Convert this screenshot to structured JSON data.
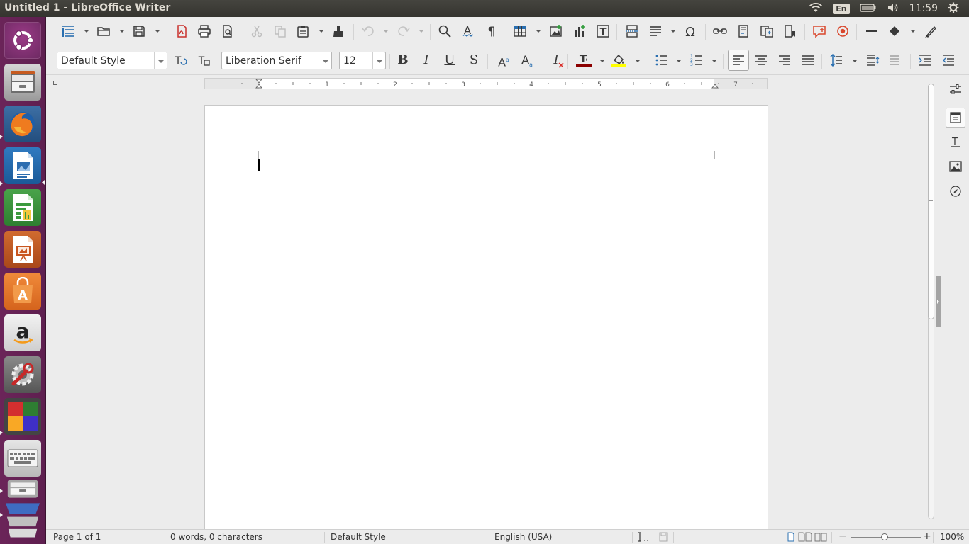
{
  "window": {
    "title": "Untitled 1 - LibreOffice Writer"
  },
  "system_tray": {
    "keyboard_layout": "En",
    "time": "11:59",
    "icons": [
      "wifi-icon",
      "keyboard-layout-indicator",
      "battery-icon",
      "volume-icon",
      "settings-gear-icon"
    ]
  },
  "launcher": {
    "items": [
      "ubuntu-dash",
      "files",
      "firefox",
      "libreoffice-writer",
      "libreoffice-calc",
      "libreoffice-impress",
      "ubuntu-software",
      "amazon",
      "system-settings",
      "workspace-switcher",
      "onscreen-keyboard",
      "files-trash-stack"
    ]
  },
  "toolbar_standard": {
    "icons": [
      "new-document",
      "open",
      "save",
      "export-pdf",
      "print",
      "print-preview",
      "cut",
      "copy",
      "paste",
      "clone-formatting",
      "undo",
      "redo",
      "find-replace",
      "spelling",
      "formatting-marks",
      "insert-table",
      "insert-image",
      "insert-chart",
      "insert-text-box",
      "insert-page-break",
      "insert-field",
      "insert-special-character",
      "insert-hyperlink",
      "insert-footnote",
      "insert-endnote",
      "insert-bookmark",
      "insert-comment",
      "track-changes",
      "insert-line",
      "basic-shapes",
      "show-draw-functions"
    ]
  },
  "toolbar_formatting": {
    "paragraph_style": "Default Style",
    "font_name": "Liberation Serif",
    "font_size": "12",
    "buttons": {
      "bold": "B",
      "italic": "I",
      "underline": "U",
      "strikethrough": "S",
      "superscript": "A",
      "subscript": "A",
      "clear_formatting": "I"
    },
    "font_color": "#8b0000",
    "highlight_color": "#ffff00",
    "icons": [
      "update-style",
      "new-style",
      "bullets",
      "numbering",
      "align-left",
      "align-center",
      "align-right",
      "justify",
      "line-spacing",
      "increase-paragraph-spacing",
      "decrease-paragraph-spacing",
      "increase-indent",
      "decrease-indent"
    ]
  },
  "ruler": {
    "labels": [
      "1",
      "2",
      "3",
      "4",
      "5",
      "6",
      "7"
    ]
  },
  "sidebar": {
    "tabs": [
      "properties",
      "styles",
      "gallery",
      "navigator",
      "page"
    ],
    "active": "properties"
  },
  "statusbar": {
    "page": "Page 1 of 1",
    "word_count": "0 words, 0 characters",
    "page_style": "Default Style",
    "language": "English (USA)",
    "zoom_level": "100%",
    "zoom_slider_minus": "−",
    "zoom_slider_plus": "+"
  }
}
